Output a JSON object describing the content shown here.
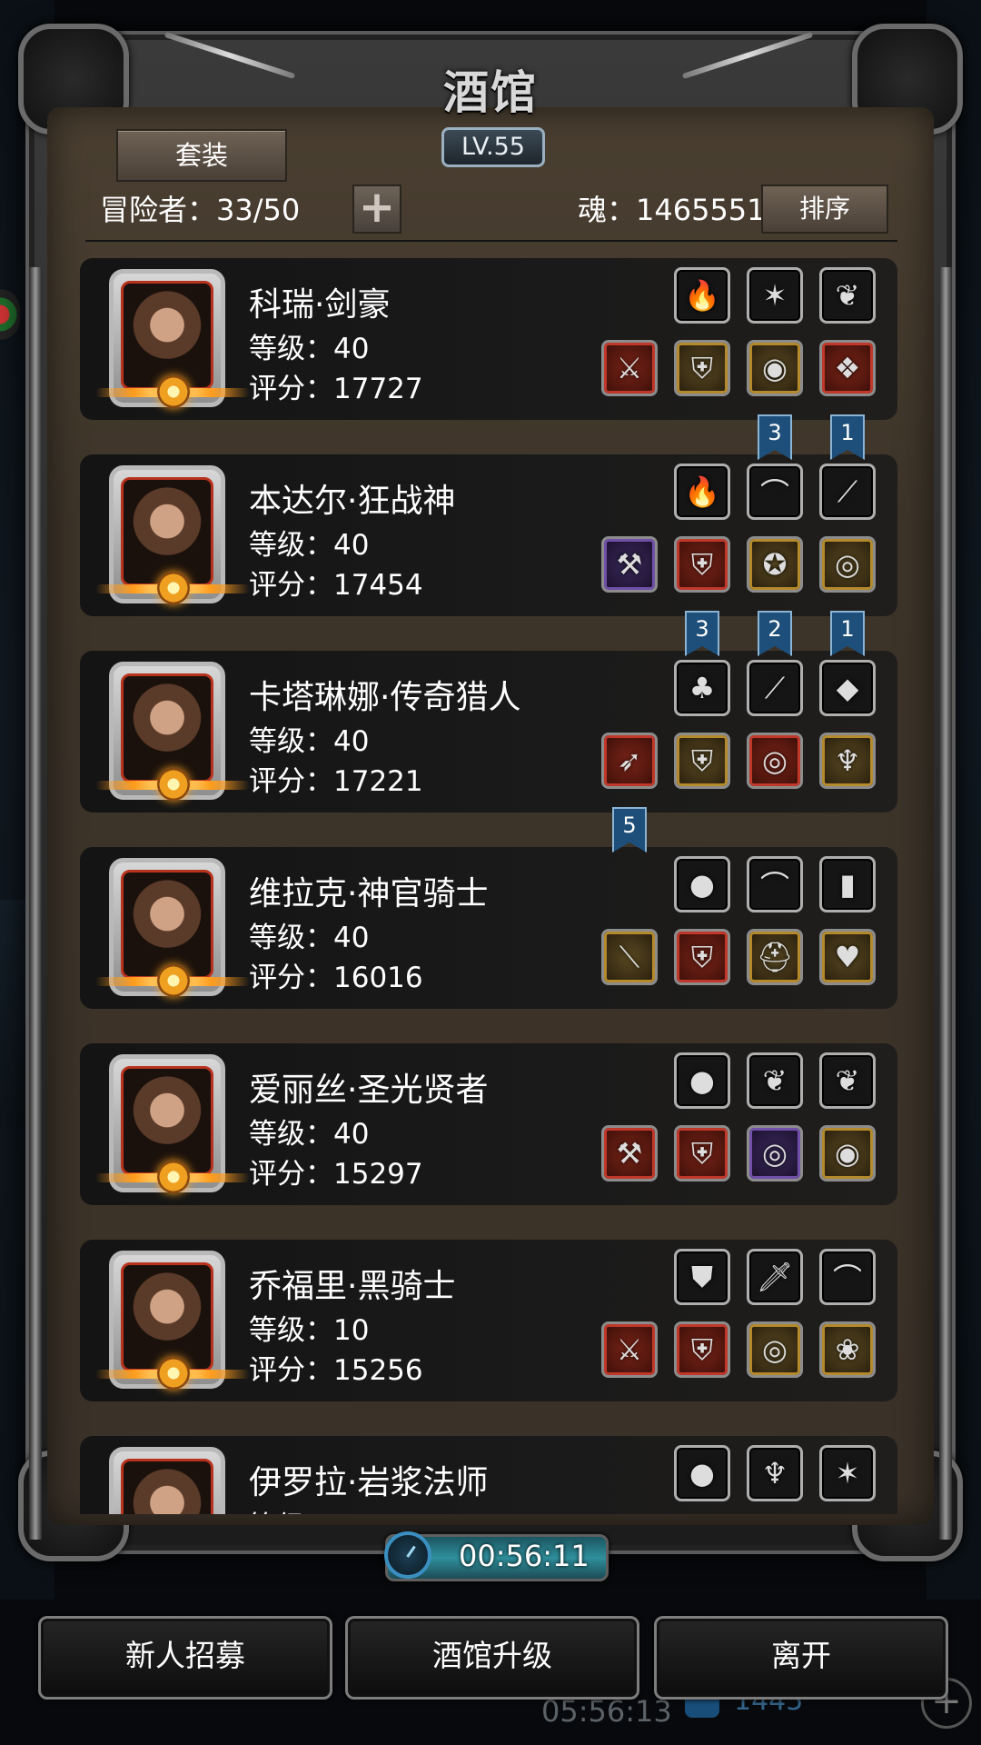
{
  "header": {
    "title": "酒馆",
    "level": "LV.55",
    "set_button": "套装",
    "adventurers_label": "冒险者：33/50",
    "plus_label": "+",
    "soul_label": "魂：1465551",
    "sort_button": "排序"
  },
  "heroes": [
    {
      "name": "科瑞·剑豪",
      "level": "等级：40",
      "score": "评分：17727",
      "top": [
        [
          "fire-orb-icon",
          "🔥",
          ""
        ],
        [
          "silver-badge-icon",
          "✶",
          ""
        ],
        [
          "angel-wing-icon",
          "❦",
          ""
        ]
      ],
      "bottom": [
        [
          "greatsword-icon",
          "⚔",
          "red"
        ],
        [
          "leather-armor-icon",
          "⛨",
          "gold"
        ],
        [
          "bracer-icon",
          "◉",
          "gold"
        ],
        [
          "red-amulet-icon",
          "❖",
          "red"
        ]
      ]
    },
    {
      "name": "本达尔·狂战神",
      "level": "等级：40",
      "score": "评分：17454",
      "top": [
        [
          "fire-orb-icon",
          "🔥",
          ""
        ],
        [
          "blue-bow-icon",
          "⌒",
          ""
        ],
        [
          "bone-staff-icon",
          "⟋",
          ""
        ]
      ],
      "bottom": [
        [
          "battle-axe-icon",
          "⚒",
          "purple"
        ],
        [
          "green-armor-icon",
          "⛨",
          "red"
        ],
        [
          "rune-seal-icon",
          "✪",
          "gold"
        ],
        [
          "skull-ring-icon",
          "◎",
          "gold"
        ]
      ]
    },
    {
      "name": "卡塔琳娜·传奇猎人",
      "level": "等级：40",
      "score": "评分：17221",
      "top": [
        [
          "green-flame-icon",
          "♣",
          ""
        ],
        [
          "bone-staff-icon",
          "⟋",
          ""
        ],
        [
          "purple-crystal-icon",
          "◆",
          ""
        ]
      ],
      "bottom": [
        [
          "crossbow-icon",
          "➶",
          "red"
        ],
        [
          "gold-armor-icon",
          "⛨",
          "gold"
        ],
        [
          "red-ring-icon",
          "◎",
          "red"
        ],
        [
          "blue-pendant-icon",
          "♆",
          "gold"
        ]
      ]
    },
    {
      "name": "维拉克·神官骑士",
      "level": "等级：40",
      "score": "评分：16016",
      "top": [
        [
          "blue-orb-icon",
          "●",
          ""
        ],
        [
          "blue-bow-icon",
          "⌒",
          ""
        ],
        [
          "tome-icon",
          "▮",
          ""
        ]
      ],
      "bottom": [
        [
          "dark-mace-icon",
          "⟍",
          "gold"
        ],
        [
          "red-armor-icon",
          "⛨",
          "red"
        ],
        [
          "knight-helm-icon",
          "⛑",
          "gold"
        ],
        [
          "heart-locket-icon",
          "♥",
          "gold"
        ]
      ]
    },
    {
      "name": "爱丽丝·圣光贤者",
      "level": "等级：40",
      "score": "评分：15297",
      "top": [
        [
          "blue-orb-icon",
          "●",
          ""
        ],
        [
          "angel-wing-icon",
          "❦",
          ""
        ],
        [
          "angel-wing-icon",
          "❦",
          ""
        ]
      ],
      "bottom": [
        [
          "war-hammer-icon",
          "⚒",
          "red"
        ],
        [
          "plate-armor-icon",
          "⛨",
          "red"
        ],
        [
          "purple-ring-icon",
          "◎",
          "purple"
        ],
        [
          "purple-bracer-icon",
          "◉",
          "gold"
        ]
      ]
    },
    {
      "name": "乔福里·黑骑士",
      "level": "等级：10",
      "score": "评分：15256",
      "top": [
        [
          "dark-shield-icon",
          "⛊",
          ""
        ],
        [
          "dagger-icon",
          "🗡",
          ""
        ],
        [
          "shortbow-icon",
          "⌒",
          ""
        ]
      ],
      "bottom": [
        [
          "broadsword-icon",
          "⚔",
          "red"
        ],
        [
          "bone-armor-icon",
          "⛨",
          "red"
        ],
        [
          "silver-ring-icon",
          "◎",
          "gold"
        ],
        [
          "green-necklace-icon",
          "❀",
          "gold"
        ]
      ]
    },
    {
      "name": "伊罗拉·岩浆法师",
      "level": "等级",
      "score": "",
      "top": [
        [
          "blue-orb-icon",
          "●",
          ""
        ],
        [
          "silver-necklace-icon",
          "♆",
          ""
        ],
        [
          "silver-badge-icon",
          "✶",
          ""
        ]
      ],
      "bottom": []
    }
  ],
  "ribbons": [
    {
      "value": "3",
      "card": 0,
      "slot": 1
    },
    {
      "value": "1",
      "card": 0,
      "slot": 2
    },
    {
      "value": "3",
      "card": 1,
      "slot": 0
    },
    {
      "value": "2",
      "card": 1,
      "slot": 1
    },
    {
      "value": "1",
      "card": 1,
      "slot": 2
    },
    {
      "value": "5",
      "card": 2,
      "slot": -1
    }
  ],
  "timer": "00:56:11",
  "buttons": {
    "recruit": "新人招募",
    "upgrade": "酒馆升级",
    "leave": "离开"
  },
  "background": {
    "timer": "05:56:13",
    "value": "1445",
    "plus": "+"
  }
}
